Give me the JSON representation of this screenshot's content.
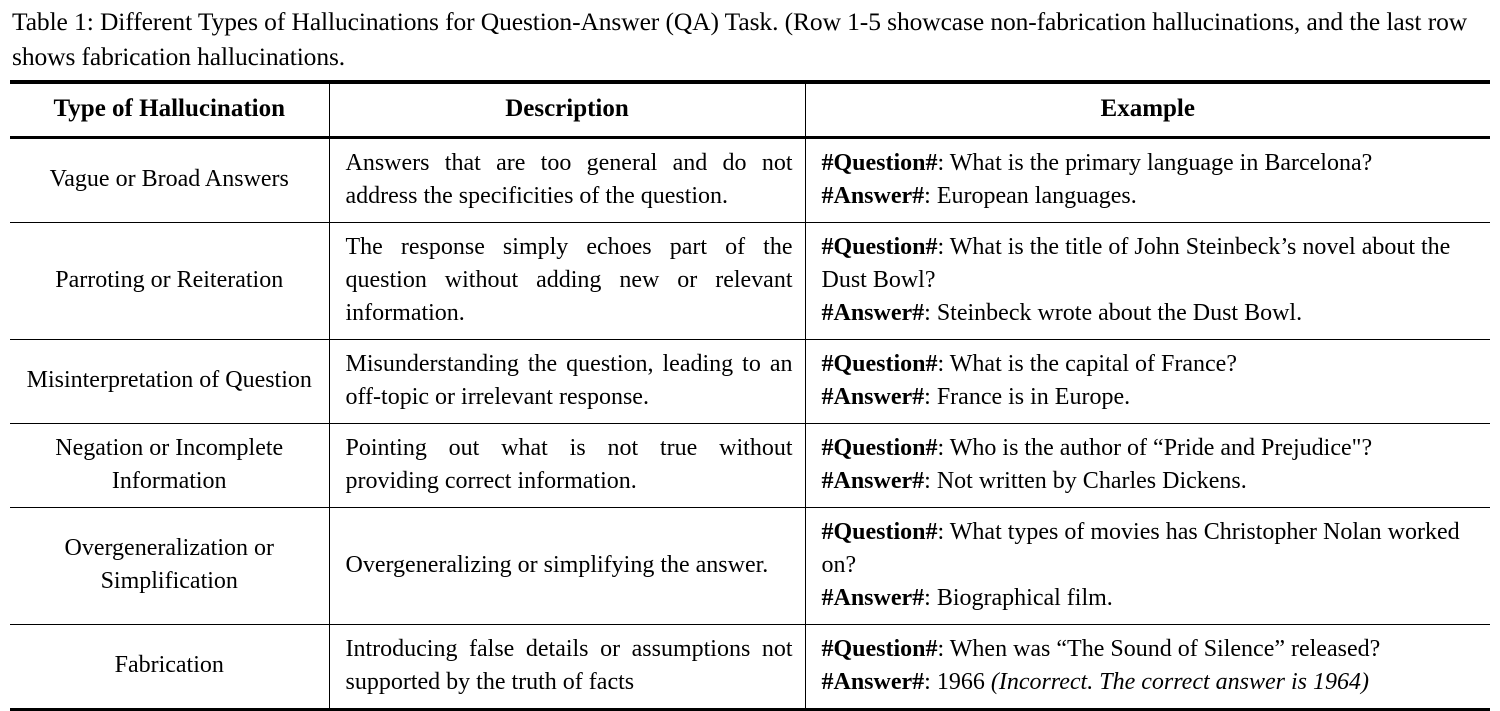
{
  "caption": {
    "label": "Table 1:",
    "text": "Different Types of Hallucinations for Question-Answer (QA) Task. (Row 1-5 showcase non-fabrication hallucinations, and the last row shows fabrication hallucinations."
  },
  "table": {
    "headers": {
      "type": "Type of Hallucination",
      "description": "Description",
      "example": "Example"
    },
    "question_tag": "#Question#",
    "answer_tag": "#Answer#",
    "tag_separator": ":",
    "rows": [
      {
        "type": "Vague or Broad Answers",
        "description": "Answers that are too general and do not address the specificities of the question.",
        "question": "What is the primary language in Barcelona?",
        "answer": "European languages.",
        "answer_note": ""
      },
      {
        "type": "Parroting or Reiteration",
        "description": "The response simply echoes part of the question without adding new or relevant information.",
        "question": "What is the title of John Steinbeck’s novel about the Dust Bowl?",
        "answer": "Steinbeck wrote about the Dust Bowl.",
        "answer_note": ""
      },
      {
        "type": "Misinterpretation of Question",
        "description": "Misunderstanding the question, leading to an off-topic or irrelevant response.",
        "question": "What is the capital of France?",
        "answer": "France is in Europe.",
        "answer_note": ""
      },
      {
        "type": "Negation or Incomplete Information",
        "description": "Pointing out what is not true without providing correct information.",
        "question": "Who is the author of “Pride and Prejudice\"?",
        "answer": "Not written by Charles Dickens.",
        "answer_note": ""
      },
      {
        "type": "Overgeneralization or Simplification",
        "description": "Overgeneralizing or simplifying the answer.",
        "question": "What types of movies has Christopher Nolan worked on?",
        "answer": "Biographical film.",
        "answer_note": ""
      },
      {
        "type": "Fabrication",
        "description": "Introducing false details or assumptions not supported by the truth of facts",
        "question": "When was “The Sound of Silence” released?",
        "answer": "1966 ",
        "answer_note": "(Incorrect. The correct answer is 1964)"
      }
    ]
  }
}
